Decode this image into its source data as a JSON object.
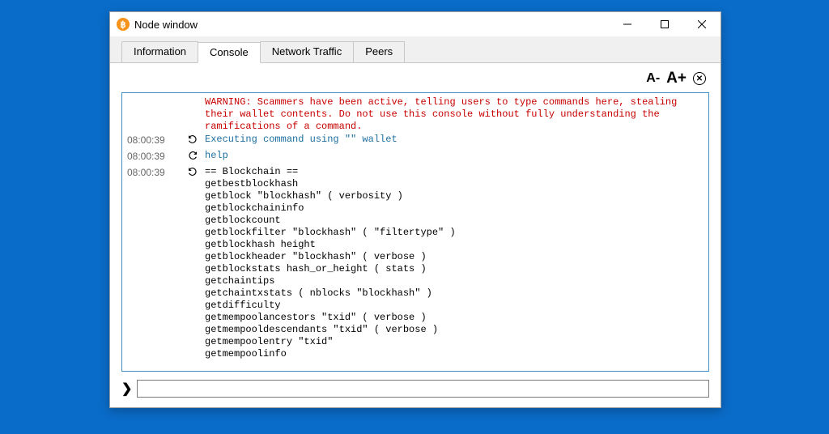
{
  "window": {
    "title": "Node window"
  },
  "tabs": [
    {
      "label": "Information"
    },
    {
      "label": "Console"
    },
    {
      "label": "Network Traffic"
    },
    {
      "label": "Peers"
    }
  ],
  "toolbar": {
    "font_dec": "A-",
    "font_inc": "A+"
  },
  "console": {
    "warning": "WARNING: Scammers have been active, telling users to type commands here, stealing their wallet contents. Do not use this console without fully understanding the ramifications of a command.",
    "lines": [
      {
        "ts": "08:00:39",
        "dir": "out",
        "cls": "cmd",
        "text": "Executing command using \"\" wallet"
      },
      {
        "ts": "08:00:39",
        "dir": "in",
        "cls": "cmd",
        "text": "help"
      },
      {
        "ts": "08:00:39",
        "dir": "out",
        "cls": "",
        "text": "== Blockchain ==\ngetbestblockhash\ngetblock \"blockhash\" ( verbosity )\ngetblockchaininfo\ngetblockcount\ngetblockfilter \"blockhash\" ( \"filtertype\" )\ngetblockhash height\ngetblockheader \"blockhash\" ( verbose )\ngetblockstats hash_or_height ( stats )\ngetchaintips\ngetchaintxstats ( nblocks \"blockhash\" )\ngetdifficulty\ngetmempoolancestors \"txid\" ( verbose )\ngetmempooldescendants \"txid\" ( verbose )\ngetmempoolentry \"txid\"\ngetmempoolinfo"
      }
    ]
  },
  "input": {
    "placeholder": ""
  }
}
